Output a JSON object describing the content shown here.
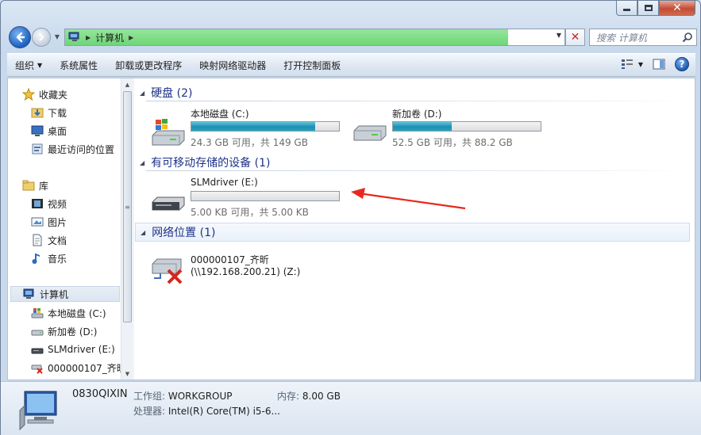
{
  "nav": {
    "breadcrumb": [
      "计算机"
    ],
    "search_placeholder": "搜索 计算机"
  },
  "toolbar": {
    "organize": "组织",
    "system_properties": "系统属性",
    "uninstall": "卸载或更改程序",
    "map_drive": "映射网络驱动器",
    "control_panel": "打开控制面板"
  },
  "sidebar": {
    "favorites": "收藏夹",
    "downloads": "下载",
    "desktop": "桌面",
    "recent": "最近访问的位置",
    "libraries": "库",
    "videos": "视频",
    "pictures": "图片",
    "documents": "文档",
    "music": "音乐",
    "computer": "计算机",
    "drive_c": "本地磁盘 (C:)",
    "drive_d": "新加卷 (D:)",
    "drive_e": "SLMdriver (E:)",
    "net_z": "000000107_齐昕"
  },
  "groups": {
    "hdd": "硬盘 (2)",
    "removable": "有可移动存储的设备 (1)",
    "network": "网络位置 (1)"
  },
  "drives": {
    "c": {
      "name": "本地磁盘 (C:)",
      "size": "24.3 GB 可用，共 149 GB",
      "used_fraction": 0.84
    },
    "d": {
      "name": "新加卷 (D:)",
      "size": "52.5 GB 可用，共 88.2 GB",
      "used_fraction": 0.4
    },
    "e": {
      "name": "SLMdriver (E:)",
      "size": "5.00 KB 可用，共 5.00 KB",
      "used_fraction": 0.0
    }
  },
  "network_drive": {
    "name": "000000107_齐昕",
    "path": "(\\\\192.168.200.21) (Z:)"
  },
  "details": {
    "computer_name": "0830QIXIN",
    "workgroup_label": "工作组:",
    "workgroup": "WORKGROUP",
    "memory_label": "内存:",
    "memory": "8.00 GB",
    "cpu_label": "处理器:",
    "cpu": "Intel(R) Core(TM) i5-6..."
  },
  "colors": {
    "address_progress": "#6fd677",
    "drive_bar": "#1d8fb0",
    "annotation_arrow": "#e8281e"
  }
}
